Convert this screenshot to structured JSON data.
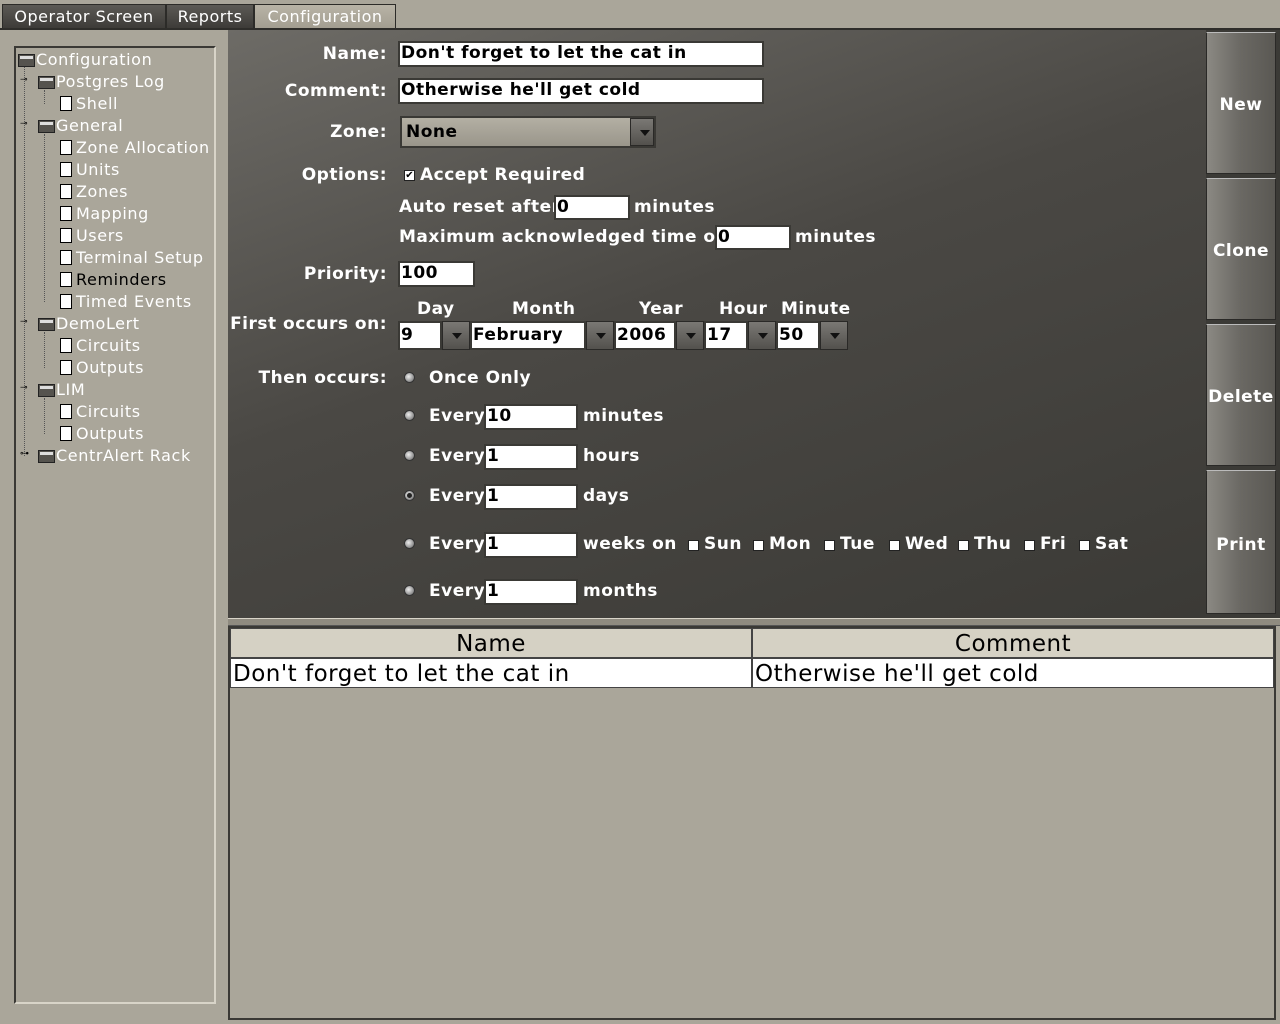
{
  "tabs": [
    {
      "label": "Operator Screen",
      "active": false
    },
    {
      "label": "Reports",
      "active": false
    },
    {
      "label": "Configuration",
      "active": true
    }
  ],
  "tree": {
    "root": "Configuration",
    "items": [
      {
        "label": "Postgres Log",
        "type": "folder"
      },
      {
        "label": "Shell",
        "type": "doc"
      },
      {
        "label": "General",
        "type": "folder"
      },
      {
        "label": "Zone Allocation",
        "type": "doc"
      },
      {
        "label": "Units",
        "type": "doc"
      },
      {
        "label": "Zones",
        "type": "doc"
      },
      {
        "label": "Mapping",
        "type": "doc"
      },
      {
        "label": "Users",
        "type": "doc"
      },
      {
        "label": "Terminal Setup",
        "type": "doc"
      },
      {
        "label": "Reminders",
        "type": "doc",
        "selected": true
      },
      {
        "label": "Timed Events",
        "type": "doc"
      },
      {
        "label": "DemoLert",
        "type": "folder"
      },
      {
        "label": "Circuits",
        "type": "doc"
      },
      {
        "label": "Outputs",
        "type": "doc"
      },
      {
        "label": "LIM",
        "type": "folder"
      },
      {
        "label": "Circuits",
        "type": "doc"
      },
      {
        "label": "Outputs",
        "type": "doc"
      },
      {
        "label": "CentrAlert Rack",
        "type": "folder"
      }
    ]
  },
  "form": {
    "name_label": "Name:",
    "name_value": "Don't forget to let the cat in",
    "comment_label": "Comment:",
    "comment_value": "Otherwise he'll get cold",
    "zone_label": "Zone:",
    "zone_value": "None",
    "options_label": "Options:",
    "accept_required": "Accept Required",
    "accept_checked": "✔",
    "auto_reset_prefix": "Auto reset after",
    "auto_reset_value": "0",
    "auto_reset_suffix": "minutes",
    "max_ack_prefix": "Maximum acknowledged time of",
    "max_ack_value": "0",
    "max_ack_suffix": "minutes",
    "priority_label": "Priority:",
    "priority_value": "100",
    "first_occurs_label": "First occurs on:",
    "date_headers": {
      "day": "Day",
      "month": "Month",
      "year": "Year",
      "hour": "Hour",
      "minute": "Minute"
    },
    "date_values": {
      "day": "9",
      "month": "February",
      "year": "2006",
      "hour": "17",
      "minute": "50"
    },
    "then_occurs_label": "Then occurs:",
    "once_only": "Once Only",
    "every": "Every",
    "minutes_value": "10",
    "minutes_unit": "minutes",
    "hours_value": "1",
    "hours_unit": "hours",
    "days_value": "1",
    "days_unit": "days",
    "weeks_value": "1",
    "weeks_unit": "weeks on",
    "weekdays": [
      "Sun",
      "Mon",
      "Tue",
      "Wed",
      "Thu",
      "Fri",
      "Sat"
    ],
    "months_value": "1",
    "months_unit": "months"
  },
  "buttons": {
    "new": "New",
    "clone": "Clone",
    "delete": "Delete",
    "print": "Print"
  },
  "table": {
    "headers": [
      "Name",
      "Comment"
    ],
    "rows": [
      [
        "Don't forget to let the cat in",
        "Otherwise he'll get cold"
      ]
    ]
  }
}
